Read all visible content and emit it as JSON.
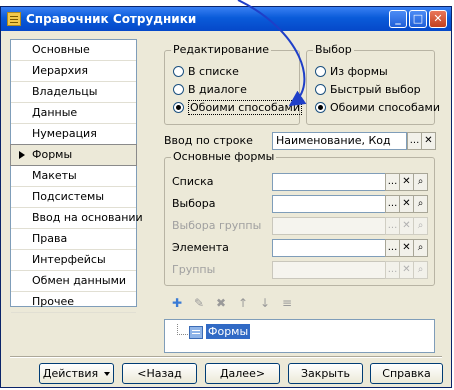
{
  "window": {
    "title": "Справочник Сотрудники",
    "controls": {
      "minimize": "_",
      "maximize": "□",
      "close": "✕"
    }
  },
  "nav": {
    "items": [
      {
        "label": "Основные"
      },
      {
        "label": "Иерархия"
      },
      {
        "label": "Владельцы"
      },
      {
        "label": "Данные"
      },
      {
        "label": "Нумерация"
      },
      {
        "label": "Формы",
        "selected": true
      },
      {
        "label": "Макеты"
      },
      {
        "label": "Подсистемы"
      },
      {
        "label": "Ввод на основании"
      },
      {
        "label": "Права"
      },
      {
        "label": "Интерфейсы"
      },
      {
        "label": "Обмен данными"
      },
      {
        "label": "Прочее"
      }
    ]
  },
  "editing": {
    "label": "Редактирование",
    "options": [
      "В списке",
      "В диалоге",
      "Обоими способами"
    ],
    "selected_index": 2
  },
  "choice": {
    "label": "Выбор",
    "options": [
      "Из формы",
      "Быстрый выбор",
      "Обоими способами"
    ],
    "selected_index": 2
  },
  "input_by_line": {
    "label": "Ввод по строке",
    "value": "Наименование, Код"
  },
  "main_forms": {
    "label": "Основные формы",
    "rows": [
      {
        "label": "Списка",
        "value": "",
        "enabled": true
      },
      {
        "label": "Выбора",
        "value": "",
        "enabled": true
      },
      {
        "label": "Выбора группы",
        "value": "",
        "enabled": false
      },
      {
        "label": "Элемента",
        "value": "",
        "enabled": true
      },
      {
        "label": "Группы",
        "value": "",
        "enabled": false
      }
    ]
  },
  "field_buttons": {
    "select": "...",
    "clear": "✕",
    "open": "🔍"
  },
  "toolbar": {
    "icons": [
      "add-form-icon",
      "edit-form-icon",
      "delete-form-icon",
      "move-up-icon",
      "move-down-icon",
      "sort-icon"
    ],
    "glyphs": [
      "✚",
      "✎",
      "✖",
      "↑",
      "↓",
      "≡"
    ]
  },
  "forms_tree": {
    "root_label": "Формы"
  },
  "buttons": {
    "actions": "Действия",
    "back": "<Назад",
    "next": "Далее>",
    "close": "Закрыть",
    "help": "Справка"
  },
  "colors": {
    "titlebar": "#0a5bd9",
    "annotation_arrow": "#1f3fc8",
    "selection": "#316ac5"
  }
}
